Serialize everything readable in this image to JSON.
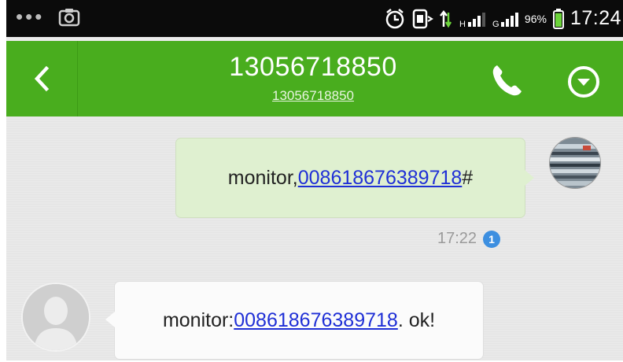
{
  "status_bar": {
    "overflow_icon": "more-dots-icon",
    "screenshot_icon": "camera-icon",
    "alarm_icon": "alarm-clock-icon",
    "nfc_icon": "nfc-icon",
    "data_icon": "data-transfer-icon",
    "signal1_label": "H",
    "signal2_label": "G",
    "battery_percent": "96%",
    "battery_level": 0.96,
    "time": "17:24"
  },
  "header": {
    "title": "13056718850",
    "subtitle": "13056718850",
    "background_color": "#49ad1e",
    "back_icon": "chevron-left-icon",
    "call_icon": "phone-icon",
    "menu_icon": "circle-chevron-down-icon"
  },
  "messages": [
    {
      "direction": "outgoing",
      "prefix": "monitor,",
      "link": "008618676389718",
      "suffix": "#",
      "time": "17:22",
      "status_badge": "1",
      "bubble_color": "#dff0d0"
    },
    {
      "direction": "incoming",
      "prefix": "monitor:",
      "link": "008618676389718",
      "suffix": ". ok!",
      "avatar_icon": "default-person-icon",
      "bubble_color": "#fbfbfb"
    }
  ]
}
